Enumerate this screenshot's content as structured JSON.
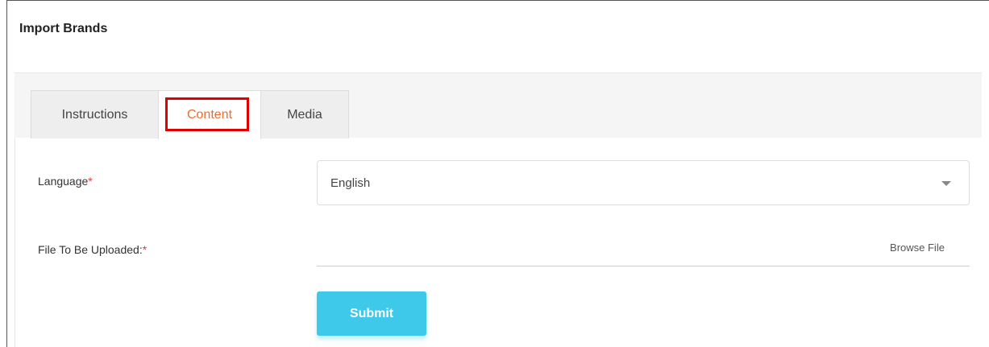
{
  "page": {
    "title": "Import Brands"
  },
  "tabs": [
    {
      "label": "Instructions"
    },
    {
      "label": "Content",
      "active": true
    },
    {
      "label": "Media"
    }
  ],
  "form": {
    "language": {
      "label": "Language",
      "required_mark": "*",
      "selected": "English"
    },
    "file": {
      "label": "File To Be Uploaded:",
      "required_mark": "*",
      "browse_label": "Browse File"
    },
    "submit_label": "Submit"
  },
  "colors": {
    "active_tab_text": "#f26a2e",
    "highlight_border": "#e00000",
    "required": "#e53935",
    "submit_bg": "#3ec8ea"
  },
  "icons": {
    "select_caret": "caret-down-icon"
  }
}
